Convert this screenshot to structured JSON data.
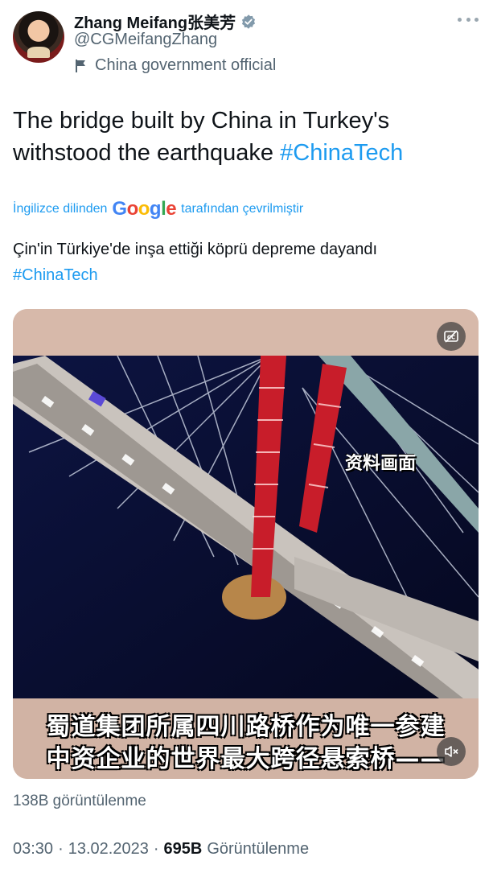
{
  "author": {
    "name": "Zhang Meifang张美芳",
    "handle": "@CGMeifangZhang",
    "label": "China government official"
  },
  "tweet": {
    "text": "The bridge built by China in Turkey's withstood the earthquake ",
    "hashtag": "#ChinaTech"
  },
  "translation": {
    "prefix": "İngilizce dilinden",
    "google": [
      "G",
      "o",
      "o",
      "g",
      "l",
      "e"
    ],
    "suffix": "tarafından çevrilmiştir",
    "text": "Çin'in Türkiye'de inşa ettiği köprü depreme dayandı",
    "hashtag": "#ChinaTech"
  },
  "media": {
    "overlay_label": "资料画面",
    "caption_line1": "蜀道集团所属四川路桥作为唯一参建",
    "caption_line2": "中资企业的世界最大跨径悬索桥——",
    "views": "138B görüntülenme"
  },
  "meta": {
    "time": "03:30",
    "separator": "·",
    "date": "13.02.2023",
    "views_count": "695B",
    "views_label": "Görüntülenme"
  },
  "icons": {
    "verified": "verified-badge-icon",
    "flag": "flag-icon",
    "more": "more-options-icon",
    "captions": "captions-off-icon",
    "mute": "speaker-muted-icon"
  },
  "colors": {
    "accent": "#1d9bf0",
    "text": "#0f1419",
    "secondary": "#536471"
  }
}
